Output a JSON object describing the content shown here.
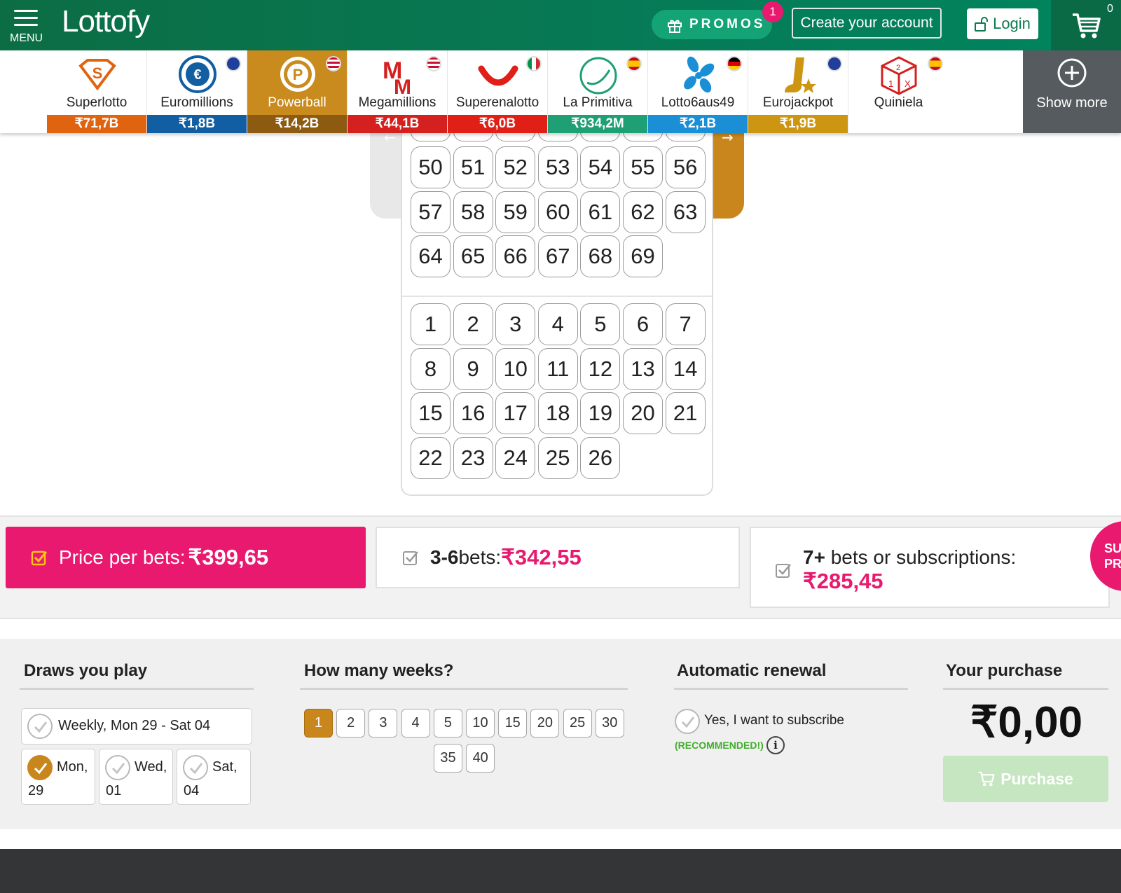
{
  "header": {
    "menu_label": "MENU",
    "logo_text": "Lottofy",
    "promos_label": "PROMOS",
    "promos_badge": "1",
    "create_account_label": "Create your account",
    "login_label": "Login",
    "cart_count": "0",
    "brand_color": "#0c6d44"
  },
  "lotteries": [
    {
      "name": "Superlotto",
      "jackpot": "₹71,7B",
      "color": "#e0640f",
      "icon": "superlotto-logo-icon",
      "flag": null
    },
    {
      "name": "Euromillions",
      "jackpot": "₹1,8B",
      "color": "#115ea3",
      "icon": "euromillions-logo-icon",
      "flag": "eu-flag-icon"
    },
    {
      "name": "Powerball",
      "jackpot": "₹14,2B",
      "color": "#8d5a12",
      "icon": "powerball-logo-icon",
      "flag": "us-flag-icon",
      "active": true
    },
    {
      "name": "Megamillions",
      "jackpot": "₹44,1B",
      "color": "#d4201f",
      "icon": "megamillions-logo-icon",
      "flag": "us-flag-icon"
    },
    {
      "name": "Superenalotto",
      "jackpot": "₹6,0B",
      "color": "#e01f17",
      "icon": "superenalotto-logo-icon",
      "flag": "it-flag-icon"
    },
    {
      "name": "La Primitiva",
      "jackpot": "₹934,2M",
      "color": "#1e9f74",
      "icon": "la-primitiva-logo-icon",
      "flag": "es-flag-icon"
    },
    {
      "name": "Lotto6aus49",
      "jackpot": "₹2,1B",
      "color": "#1a8fd6",
      "icon": "lotto6aus49-logo-icon",
      "flag": "de-flag-icon"
    },
    {
      "name": "Eurojackpot",
      "jackpot": "₹1,9B",
      "color": "#cd9612",
      "icon": "eurojackpot-logo-icon",
      "flag": "eu-flag-icon"
    },
    {
      "name": "Quiniela",
      "jackpot": null,
      "color": null,
      "icon": "quiniela-logo-icon",
      "flag": "es-flag-icon"
    }
  ],
  "show_more_label": "Show more",
  "main_numbers": [
    "50",
    "51",
    "52",
    "53",
    "54",
    "55",
    "56",
    "57",
    "58",
    "59",
    "60",
    "61",
    "62",
    "63",
    "64",
    "65",
    "66",
    "67",
    "68",
    "69"
  ],
  "power_numbers": [
    "1",
    "2",
    "3",
    "4",
    "5",
    "6",
    "7",
    "8",
    "9",
    "10",
    "11",
    "12",
    "13",
    "14",
    "15",
    "16",
    "17",
    "18",
    "19",
    "20",
    "21",
    "22",
    "23",
    "24",
    "25",
    "26"
  ],
  "pricing": {
    "tier1_label": "Price per bets: ",
    "tier1_value": "₹399,65",
    "tier2_count": "3-6",
    "tier2_label": " bets: ",
    "tier2_value": "₹342,55",
    "tier3_count": "7+",
    "tier3_label": " bets or subscriptions:",
    "tier3_value": "₹285,45",
    "badge_line1": "SUB",
    "badge_line2": "PR"
  },
  "options": {
    "draws_title": "Draws you play",
    "weekly_label": "Weekly, Mon 29 - Sat 04",
    "draws": [
      {
        "day": "Mon,",
        "date": "29",
        "checked": true
      },
      {
        "day": "Wed,",
        "date": "01",
        "checked": false
      },
      {
        "day": "Sat,",
        "date": "04",
        "checked": false
      }
    ],
    "weeks_title": "How many weeks?",
    "weeks": [
      "1",
      "2",
      "3",
      "4",
      "5",
      "10",
      "15",
      "20",
      "25",
      "30",
      "35",
      "40"
    ],
    "weeks_selected": "1",
    "renewal_title": "Automatic renewal",
    "subscribe_label": "Yes, I want to subscribe",
    "recommended_label": "(RECOMMENDED!)",
    "purchase_title": "Your purchase",
    "total": "₹0,00",
    "purchase_label": "Purchase"
  }
}
